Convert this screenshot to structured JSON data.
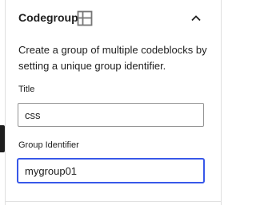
{
  "panel": {
    "title": "Codegroup",
    "block_icon": "codegroup-block-icon",
    "toggle_icon": "chevron-up-icon",
    "description": "Create a group of multiple codeblocks by setting a unique group identifier.",
    "accent_color": "#3858e9"
  },
  "fields": {
    "title_label": "Title",
    "title_value": "css",
    "group_label": "Group Identifier",
    "group_value": "mygroup01"
  }
}
